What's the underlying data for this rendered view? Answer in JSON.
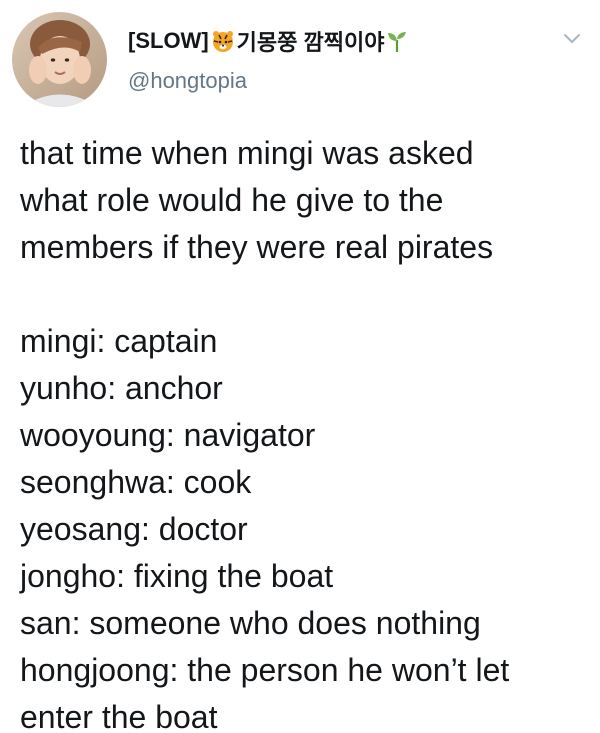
{
  "tweet": {
    "display_name": "[SLOW]",
    "display_name_korean": "기몽쭝 깜찍이야",
    "name_emoji_1": "tiger-face-icon",
    "name_emoji_2": "seedling-icon",
    "handle": "@hongtopia",
    "menu_icon": "chevron-down-icon",
    "intro_lines": [
      "that time when mingi was asked",
      "what role would he give to the",
      "members if they were real pirates"
    ],
    "role_lines": [
      "mingi: captain",
      "yunho: anchor",
      "wooyoung: navigator",
      "seonghwa: cook",
      "yeosang: doctor",
      "jongho: fixing the boat",
      "san: someone who does nothing",
      "hongjoong: the person he won’t let",
      "enter the boat"
    ]
  }
}
